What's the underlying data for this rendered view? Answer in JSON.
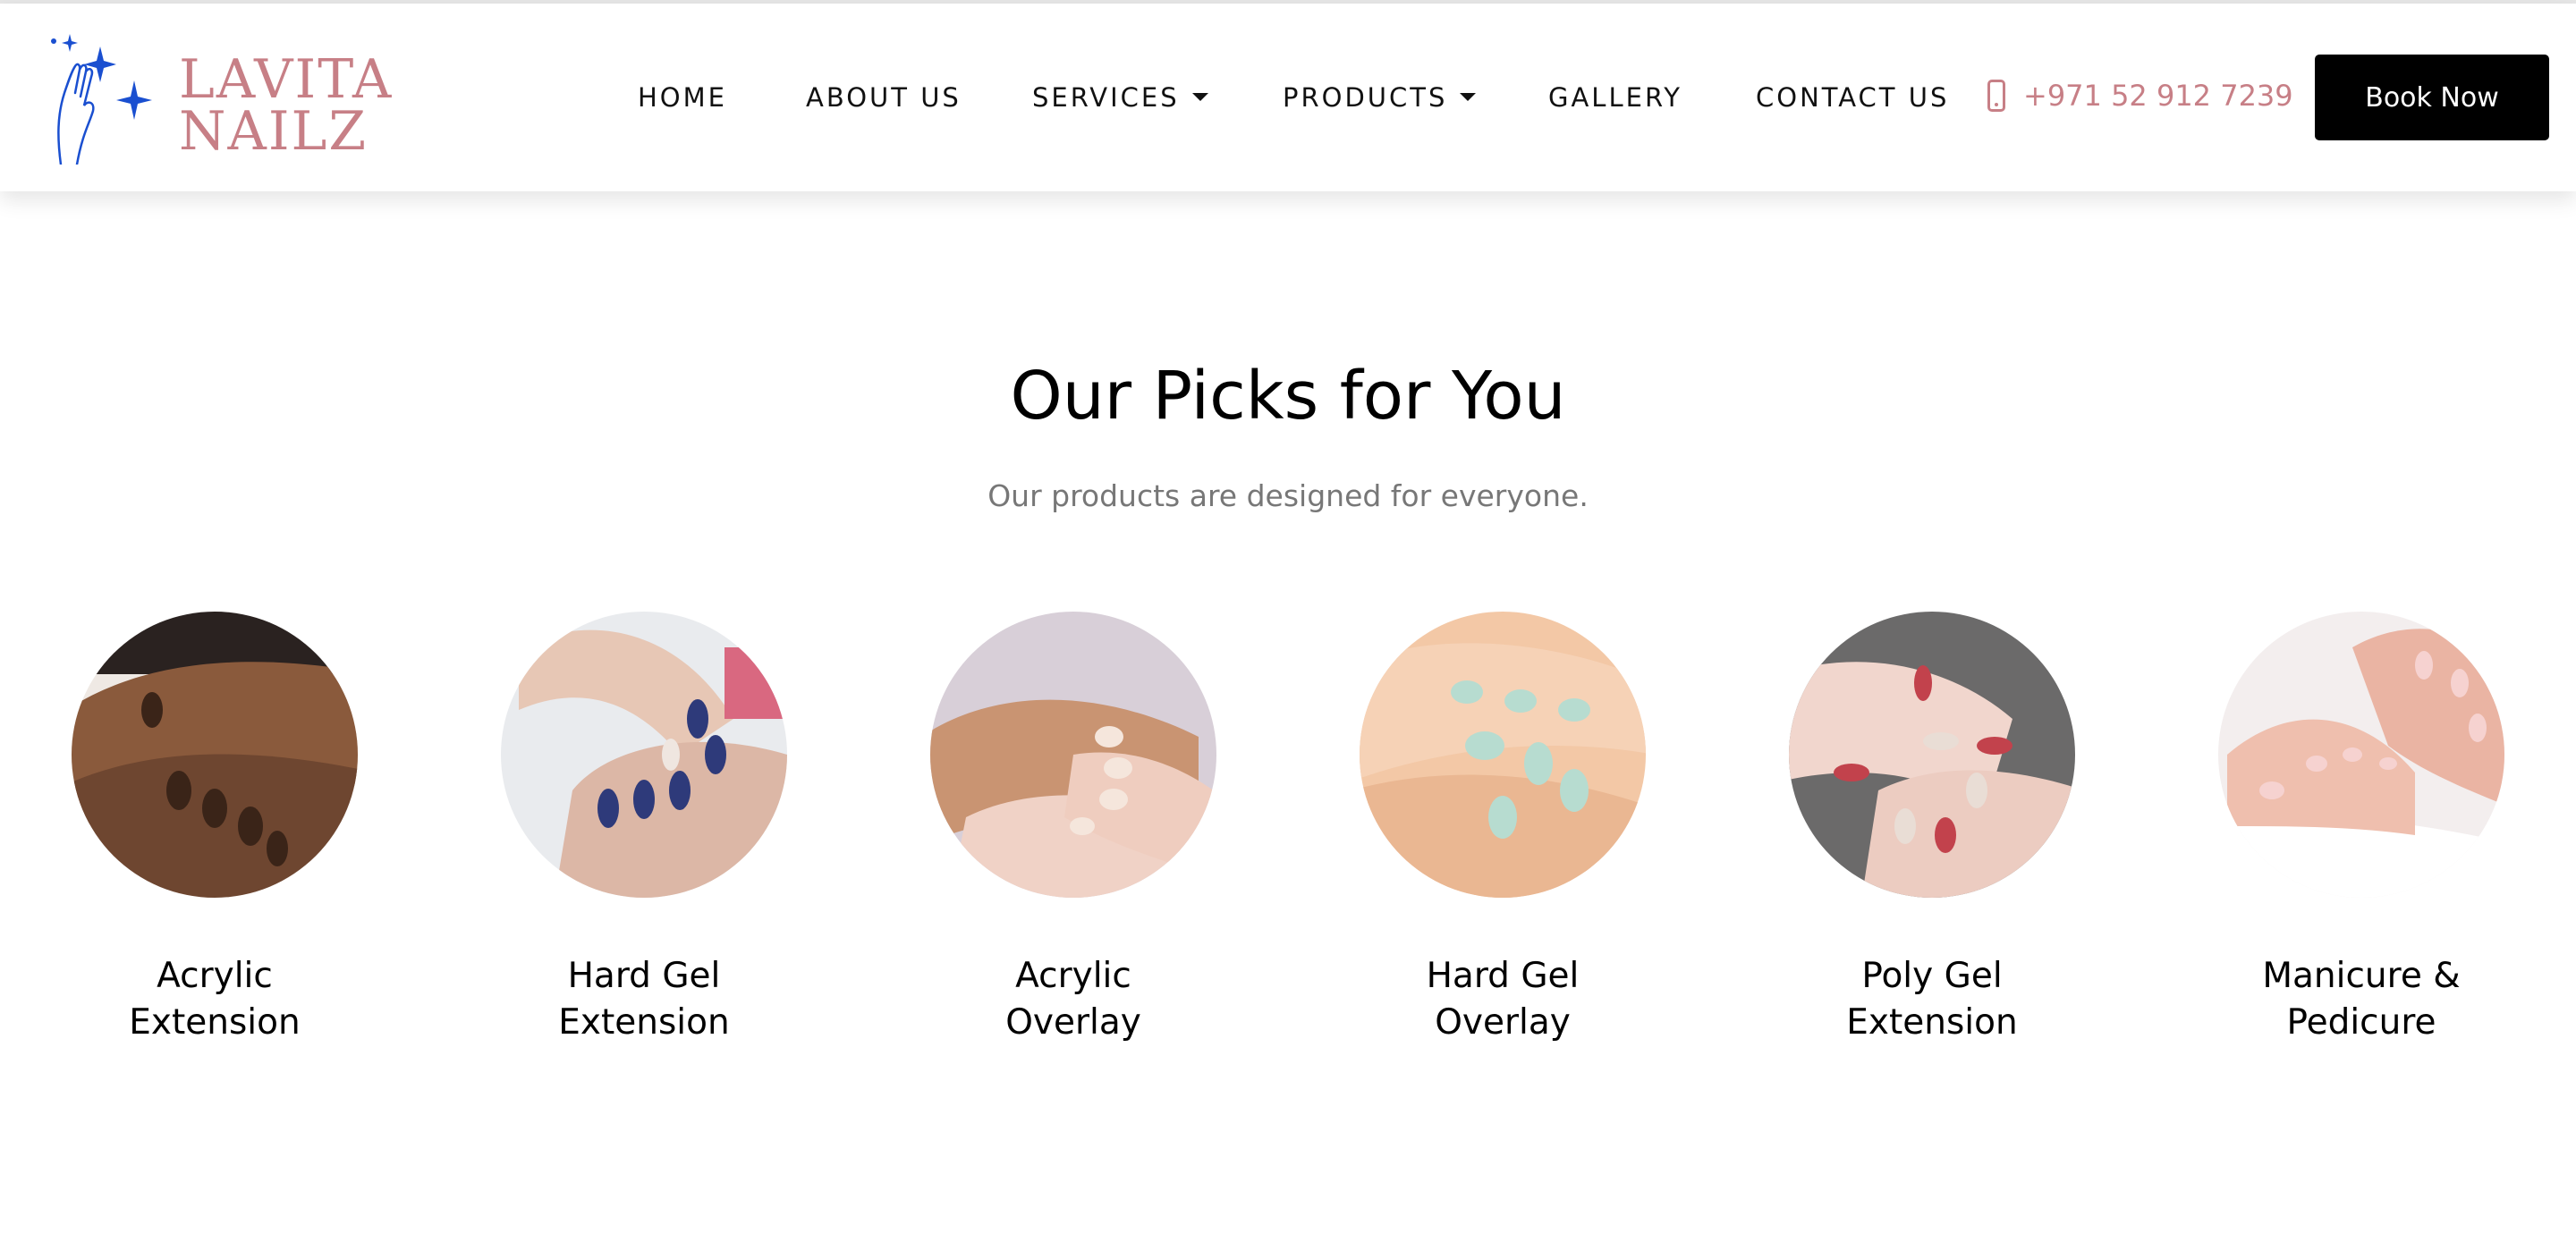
{
  "brand": {
    "logo_line1": "LAVITA",
    "logo_line2": "NAILZ",
    "logo_color": "#c77f86",
    "logo_icon_color": "#1a4fd0"
  },
  "nav": {
    "items": [
      {
        "label": "HOME",
        "dropdown": false
      },
      {
        "label": "ABOUT US",
        "dropdown": false
      },
      {
        "label": "SERVICES",
        "dropdown": true
      },
      {
        "label": "PRODUCTS",
        "dropdown": true
      },
      {
        "label": "GALLERY",
        "dropdown": false
      },
      {
        "label": "CONTACT US",
        "dropdown": false
      }
    ]
  },
  "contact": {
    "icon": "mobile-phone-icon",
    "phone": "+971 52 912 7239",
    "accent": "#c77f86"
  },
  "header_cta": {
    "label": "Book Now",
    "background": "#000000"
  },
  "picks": {
    "title": "Our Picks for You",
    "subtitle": "Our products are designed for everyone.",
    "items": [
      {
        "line1": "Acrylic",
        "line2": "Extension",
        "image": "acrylic-extension-photo"
      },
      {
        "line1": "Hard Gel",
        "line2": "Extension",
        "image": "hard-gel-extension-photo"
      },
      {
        "line1": "Acrylic",
        "line2": "Overlay",
        "image": "acrylic-overlay-photo"
      },
      {
        "line1": "Hard Gel",
        "line2": "Overlay",
        "image": "hard-gel-overlay-photo"
      },
      {
        "line1": "Poly Gel",
        "line2": "Extension",
        "image": "poly-gel-extension-photo"
      },
      {
        "line1": "Manicure &",
        "line2": "Pedicure",
        "image": "manicure-pedicure-photo"
      }
    ]
  }
}
